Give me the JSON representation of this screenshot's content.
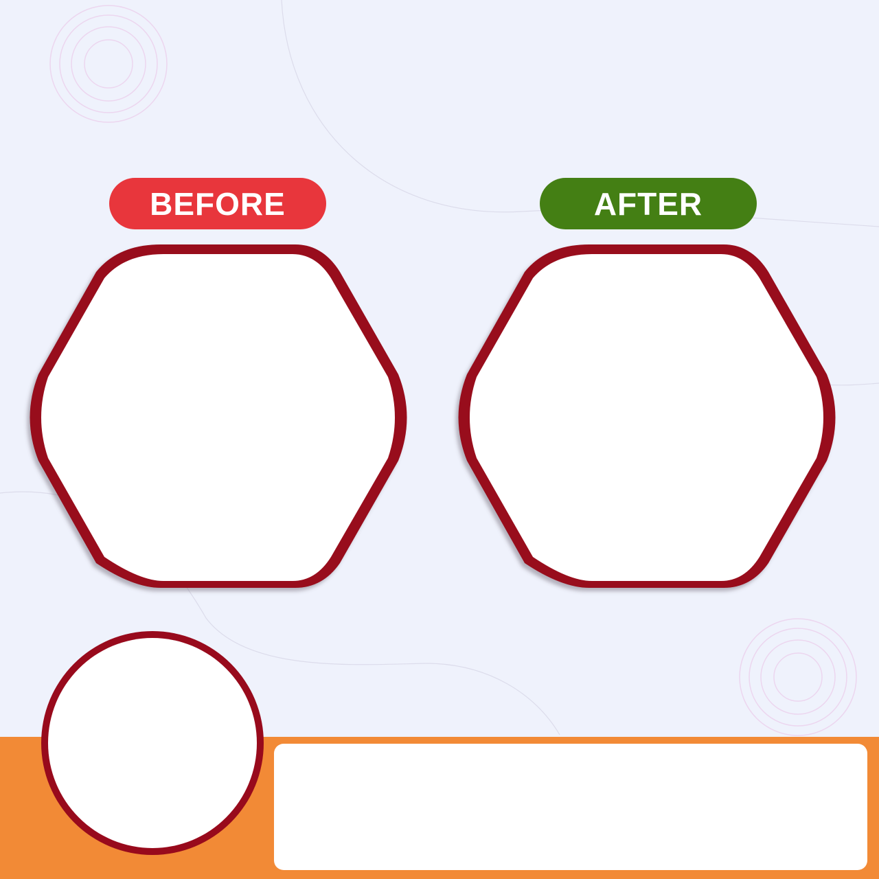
{
  "labels": {
    "before": "BEFORE",
    "after": "AFTER"
  },
  "colors": {
    "background": "#eff2fc",
    "before_accent": "#e8363c",
    "after_accent": "#447f14",
    "frame_stroke": "#980a1c",
    "frame_fill": "#ffffff",
    "footer_band": "#f28a36",
    "decor_rings": "#ecd6ef",
    "decor_curve": "#dcdceb"
  }
}
